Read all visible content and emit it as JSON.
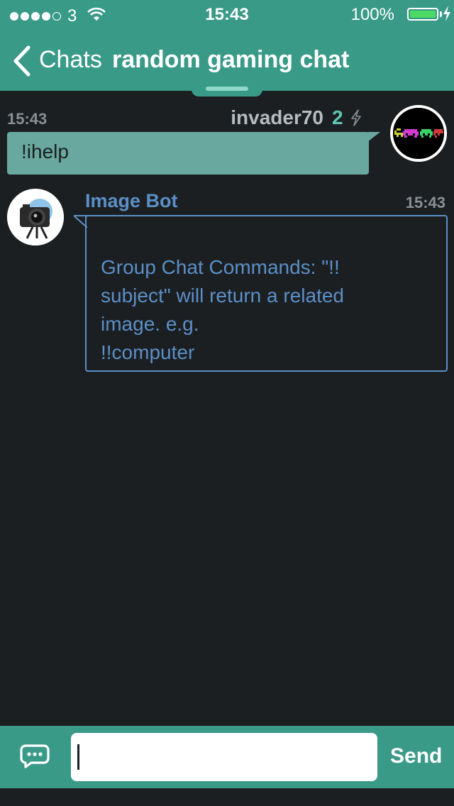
{
  "status_bar": {
    "carrier": "3",
    "time": "15:43",
    "battery": "100%",
    "signal_bars": 4,
    "signal_max": 5
  },
  "nav": {
    "back_label": "Chats",
    "title": "random gaming chat"
  },
  "messages": [
    {
      "time": "15:43",
      "sender": "invader70",
      "level": "2",
      "text": "!ihelp",
      "avatar": "space-invaders-avatar"
    },
    {
      "time": "15:43",
      "sender": "Image Bot",
      "text": "Group Chat Commands: \"!!\nsubject\" will return a related\nimage. e.g.\n!!computer",
      "avatar": "camera-avatar"
    }
  ],
  "composer": {
    "value": "",
    "send_label": "Send"
  },
  "colors": {
    "accent": "#3a9a88",
    "background": "#1b1f22",
    "own_bubble": "#69a89e",
    "bot_blue": "#5c8fc7",
    "level_teal": "#5fc6b3"
  }
}
